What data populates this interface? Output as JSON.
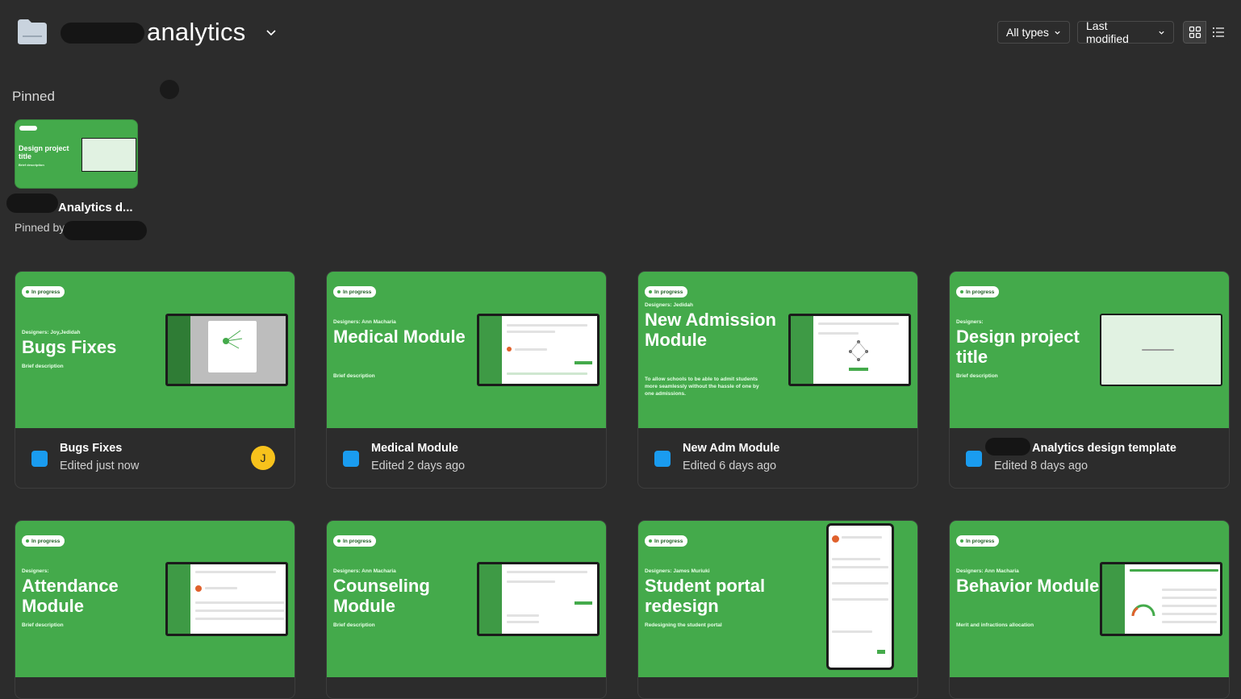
{
  "header": {
    "folder_title": "analytics",
    "filter_type_label": "All types",
    "sort_label": "Last modified"
  },
  "pinned": {
    "section_label": "Pinned",
    "item": {
      "name": "Analytics d...",
      "pinned_by": "Pinned by",
      "thumb_title": "Design project title",
      "thumb_desc": "Brief description"
    }
  },
  "cards": [
    {
      "name": "Bugs Fixes",
      "edited": "Edited just now",
      "badge": "In progress",
      "designer": "Designers: Joy,Jedidah",
      "title": "Bugs Fixes",
      "desc": "Brief description",
      "avatar": "J"
    },
    {
      "name": "Medical Module",
      "edited": "Edited 2 days ago",
      "badge": "In progress",
      "designer": "Designers: Ann Macharia",
      "title": "Medical Module",
      "desc": "Brief description"
    },
    {
      "name": "New Adm Module",
      "edited": "Edited 6 days ago",
      "badge": "In progress",
      "designer": "Designers: Jedidah",
      "title": "New Admission Module",
      "desc": "To allow schools to be able to admit students more seamlessly without the hassle of one by one admissions."
    },
    {
      "name": "Analytics design template",
      "edited": "Edited 8 days ago",
      "badge": "In progress",
      "designer": "Designers:",
      "title": "Design project title",
      "desc": "Brief description"
    },
    {
      "badge": "In progress",
      "designer": "Designers:",
      "title": "Attendance Module",
      "desc": "Brief description"
    },
    {
      "badge": "In progress",
      "designer": "Designers: Ann Macharia",
      "title": "Counseling Module",
      "desc": "Brief description"
    },
    {
      "badge": "In progress",
      "designer": "Designers: James Muriuki",
      "title": "Student portal redesign",
      "desc": "Redesigning the student portal"
    },
    {
      "badge": "In progress",
      "designer": "Designers: Ann Macharia",
      "title": "Behavior Module",
      "desc": "Merit and infractions allocation"
    }
  ]
}
